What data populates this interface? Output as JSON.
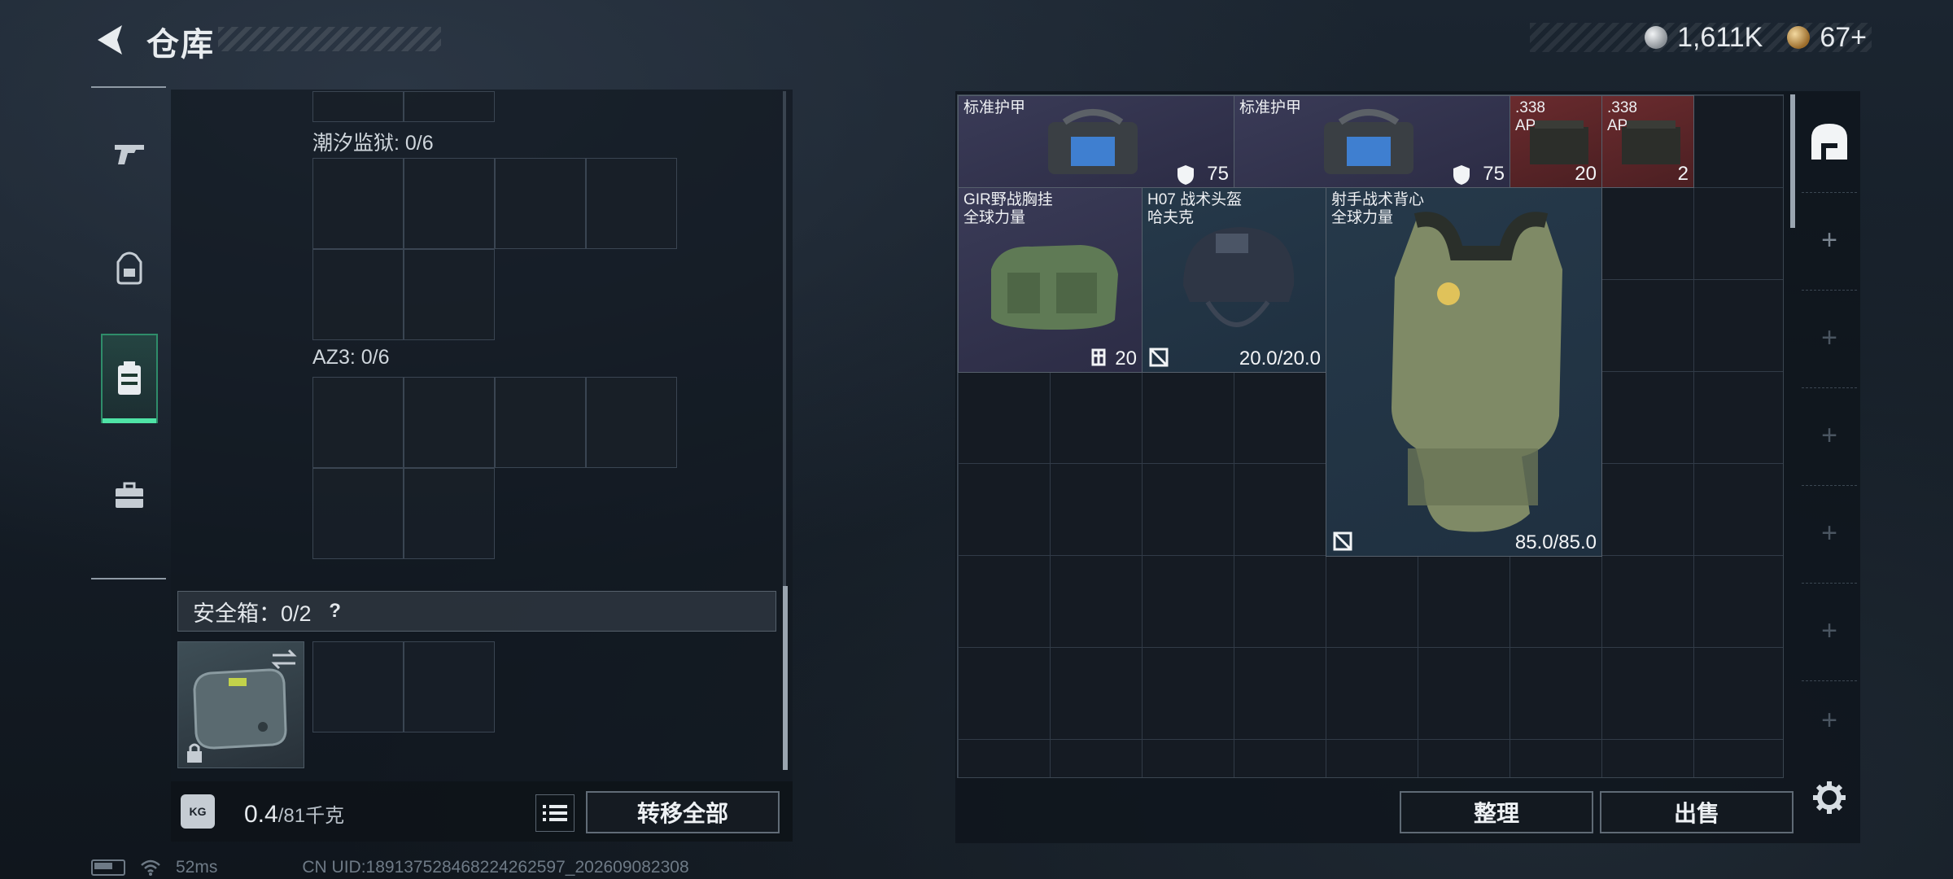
{
  "header": {
    "title": "仓库",
    "currencies": [
      {
        "icon": "silver-coin-icon",
        "value": "1,611K"
      },
      {
        "icon": "gold-coin-icon",
        "value": "67+"
      }
    ]
  },
  "sidebar": {
    "items": [
      {
        "icon": "pistol-icon"
      },
      {
        "icon": "backpack-icon"
      },
      {
        "icon": "storage-case-icon",
        "active": true
      },
      {
        "icon": "toolbox-icon"
      }
    ]
  },
  "left_panel": {
    "containers": [
      {
        "label": "潮汐监狱: 0/6"
      },
      {
        "label": "AZ3: 0/6"
      }
    ],
    "safe_box": {
      "label": "安全箱：0/2",
      "help": "?"
    },
    "weight": {
      "icon_label": "KG",
      "current": "0.4",
      "max": "/81千克"
    },
    "transfer_label": "转移全部"
  },
  "storage": {
    "items": [
      {
        "name": "标准护甲",
        "stat": "75",
        "color": "purple"
      },
      {
        "name": "标准护甲",
        "stat": "75",
        "color": "purple"
      },
      {
        "name": ".338\nAP",
        "stat": "20",
        "color": "red"
      },
      {
        "name": ".338\nAP",
        "stat": "2",
        "color": "red"
      },
      {
        "name": "GIR野战胸挂\n全球力量",
        "stat": "20",
        "color": "purple"
      },
      {
        "name": "H07 战术头盔\n哈夫克",
        "stat": "20.0/20.0",
        "color": "blue"
      },
      {
        "name": "射手战术背心\n全球力量",
        "stat": "85.0/85.0",
        "color": "blue"
      }
    ],
    "sort_label": "整理",
    "sell_label": "出售"
  },
  "status_bar": {
    "ping": "52ms",
    "uid": "CN UID:1891375284682242625​97_202609082308"
  }
}
